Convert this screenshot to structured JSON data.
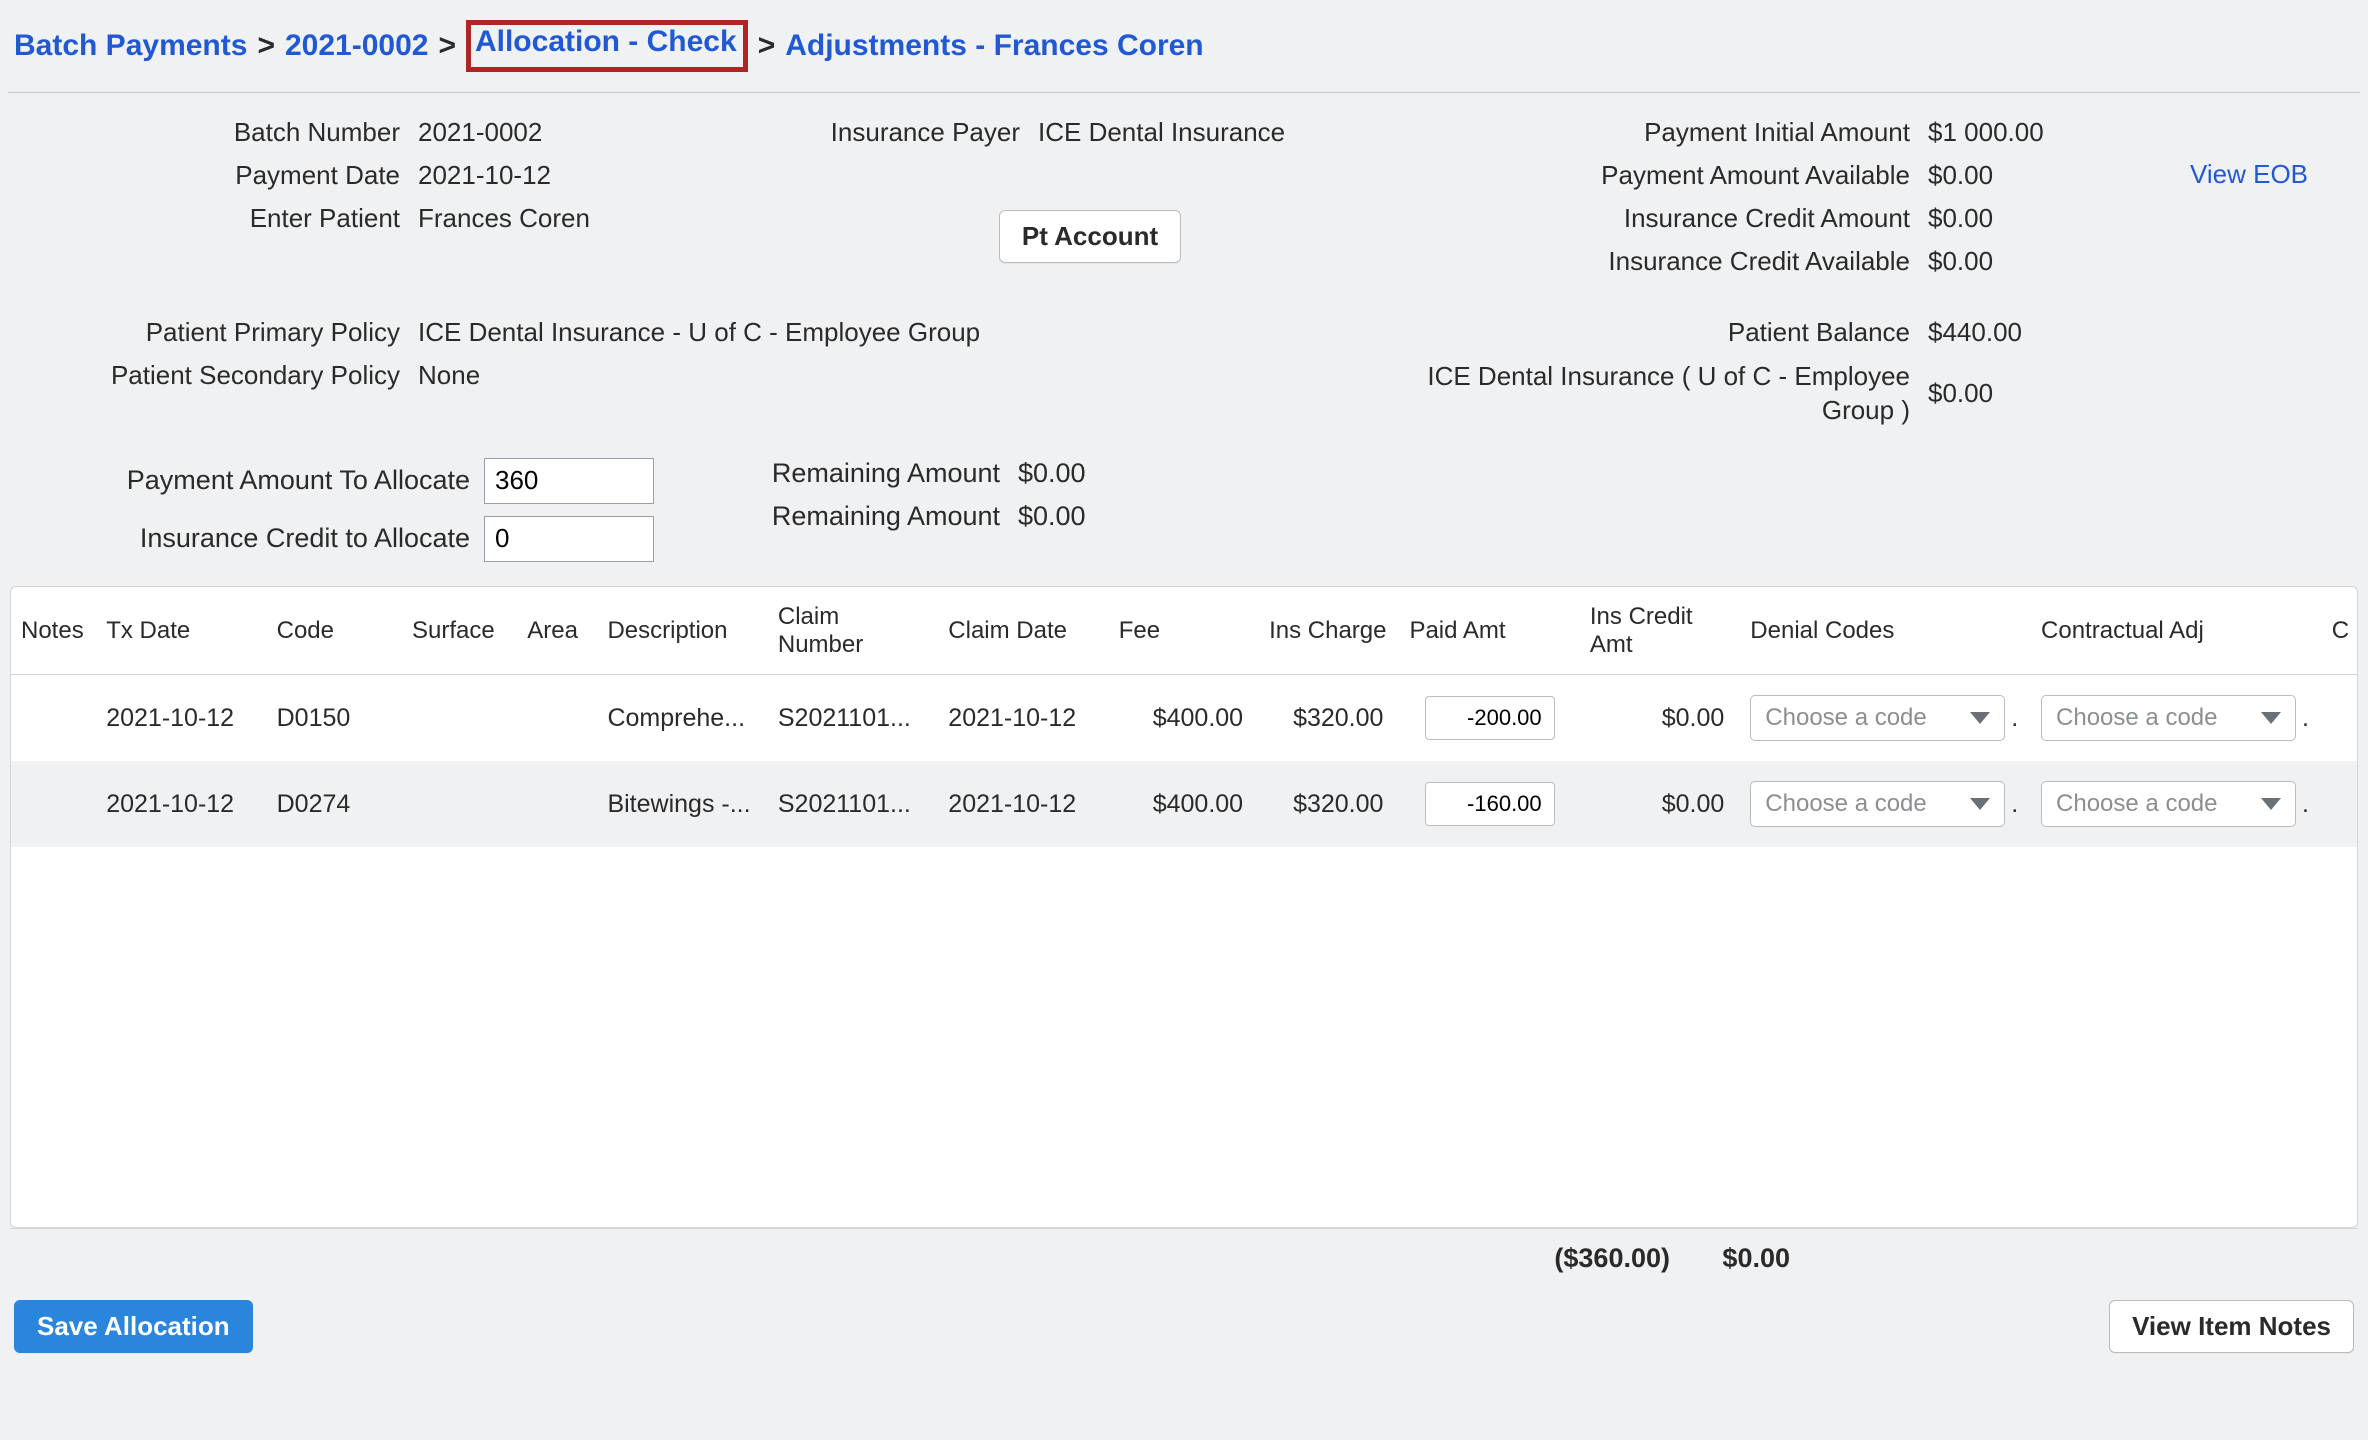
{
  "breadcrumb": {
    "items": [
      {
        "label": "Batch Payments"
      },
      {
        "label": "2021-0002"
      },
      {
        "label": "Allocation - Check"
      },
      {
        "label": "Adjustments - Frances Coren"
      }
    ],
    "separator": ">"
  },
  "header": {
    "batchNumber": {
      "label": "Batch Number",
      "value": "2021-0002"
    },
    "paymentDate": {
      "label": "Payment Date",
      "value": "2021-10-12"
    },
    "enterPatient": {
      "label": "Enter Patient",
      "value": "Frances Coren"
    },
    "insurancePayer": {
      "label": "Insurance Payer",
      "value": "ICE Dental Insurance"
    },
    "ptAccountBtn": "Pt Account",
    "paymentInitial": {
      "label": "Payment Initial Amount",
      "value": "$1 000.00"
    },
    "paymentAvail": {
      "label": "Payment Amount Available",
      "value": "$0.00"
    },
    "insCreditAmt": {
      "label": "Insurance Credit Amount",
      "value": "$0.00"
    },
    "insCreditAvail": {
      "label": "Insurance Credit Available",
      "value": "$0.00"
    },
    "viewEob": "View EOB",
    "primaryPolicy": {
      "label": "Patient Primary Policy",
      "value": "ICE Dental Insurance - U of C - Employee Group"
    },
    "secondaryPolicy": {
      "label": "Patient Secondary Policy",
      "value": "None"
    },
    "patientBalance": {
      "label": "Patient Balance",
      "value": "$440.00"
    },
    "iceGroup": {
      "label": "ICE Dental Insurance ( U of C - Employee Group )",
      "value": "$0.00"
    }
  },
  "allocate": {
    "paymentToAllocate": {
      "label": "Payment Amount To Allocate",
      "value": "360"
    },
    "insCreditToAllocate": {
      "label": "Insurance Credit to Allocate",
      "value": "0"
    },
    "remaining1": {
      "label": "Remaining Amount",
      "value": "$0.00"
    },
    "remaining2": {
      "label": "Remaining Amount",
      "value": "$0.00"
    }
  },
  "table": {
    "headers": {
      "notes": "Notes",
      "txDate": "Tx Date",
      "code": "Code",
      "surface": "Surface",
      "area": "Area",
      "description": "Description",
      "claimNumber": "Claim Number",
      "claimDate": "Claim Date",
      "fee": "Fee",
      "insCharge": "Ins Charge",
      "paidAmt": "Paid Amt",
      "insCreditAmt": "Ins Credit Amt",
      "denialCodes": "Denial Codes",
      "contractualAdj": "Contractual Adj",
      "c": "C"
    },
    "rows": [
      {
        "txDate": "2021-10-12",
        "code": "D0150",
        "description": "Comprehe...",
        "claimNumber": "S2021101...",
        "claimDate": "2021-10-12",
        "fee": "$400.00",
        "insCharge": "$320.00",
        "paidAmt": "-200.00",
        "insCreditAmt": "$0.00",
        "denialPlaceholder": "Choose a code",
        "adjPlaceholder": "Choose a code"
      },
      {
        "txDate": "2021-10-12",
        "code": "D0274",
        "description": "Bitewings -...",
        "claimNumber": "S2021101...",
        "claimDate": "2021-10-12",
        "fee": "$400.00",
        "insCharge": "$320.00",
        "paidAmt": "-160.00",
        "insCreditAmt": "$0.00",
        "denialPlaceholder": "Choose a code",
        "adjPlaceholder": "Choose a code"
      }
    ]
  },
  "totals": {
    "paid": "($360.00)",
    "credit": "$0.00"
  },
  "footer": {
    "saveBtn": "Save Allocation",
    "notesBtn": "View Item Notes"
  }
}
